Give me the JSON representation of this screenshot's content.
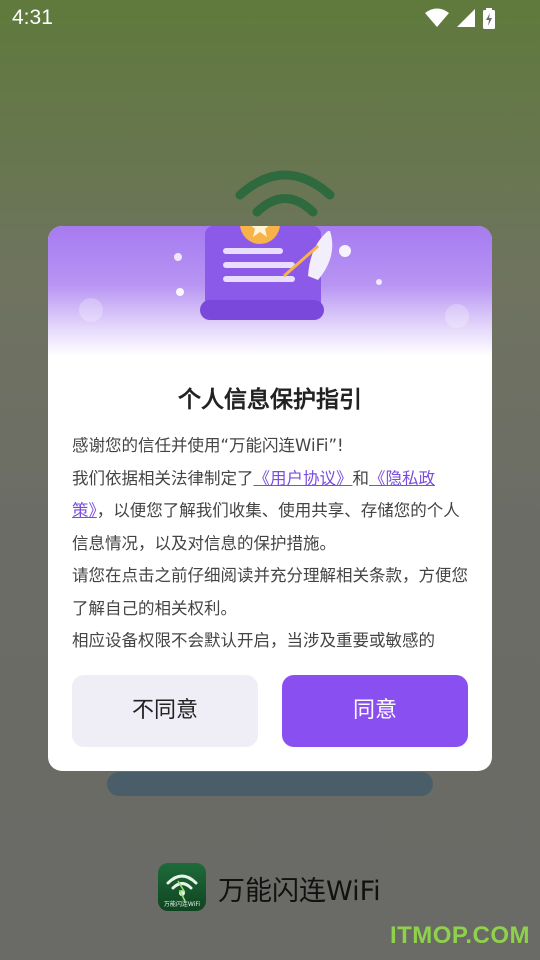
{
  "status_bar": {
    "time": "4:31"
  },
  "dialog": {
    "title": "个人信息保护指引",
    "para1": "感谢您的信任并使用“万能闪连WiFi”!",
    "para2_prefix": "我们依据相关法律制定了",
    "user_agreement_link": "《用户协议》",
    "para2_and": "和",
    "privacy_policy_link": "《隐私政策》",
    "para2_suffix": "，以便您了解我们收集、使用共享、存储您的个人信息情况，以及对信息的保护措施。",
    "para3": "请您在点击之前仔细阅读并充分理解相关条款，方便您了解自己的相关权利。",
    "para4": "相应设备权限不会默认开启，当涉及重要或敏感的",
    "disagree_label": "不同意",
    "agree_label": "同意"
  },
  "brand": {
    "name": "万能闪连WiFi",
    "logo_text": "万能闪连WiFi"
  },
  "watermark": "ITMOP.COM",
  "colors": {
    "accent": "#8a4ff0",
    "link": "#7a4de0",
    "brand_green": "#1e6b3a"
  }
}
